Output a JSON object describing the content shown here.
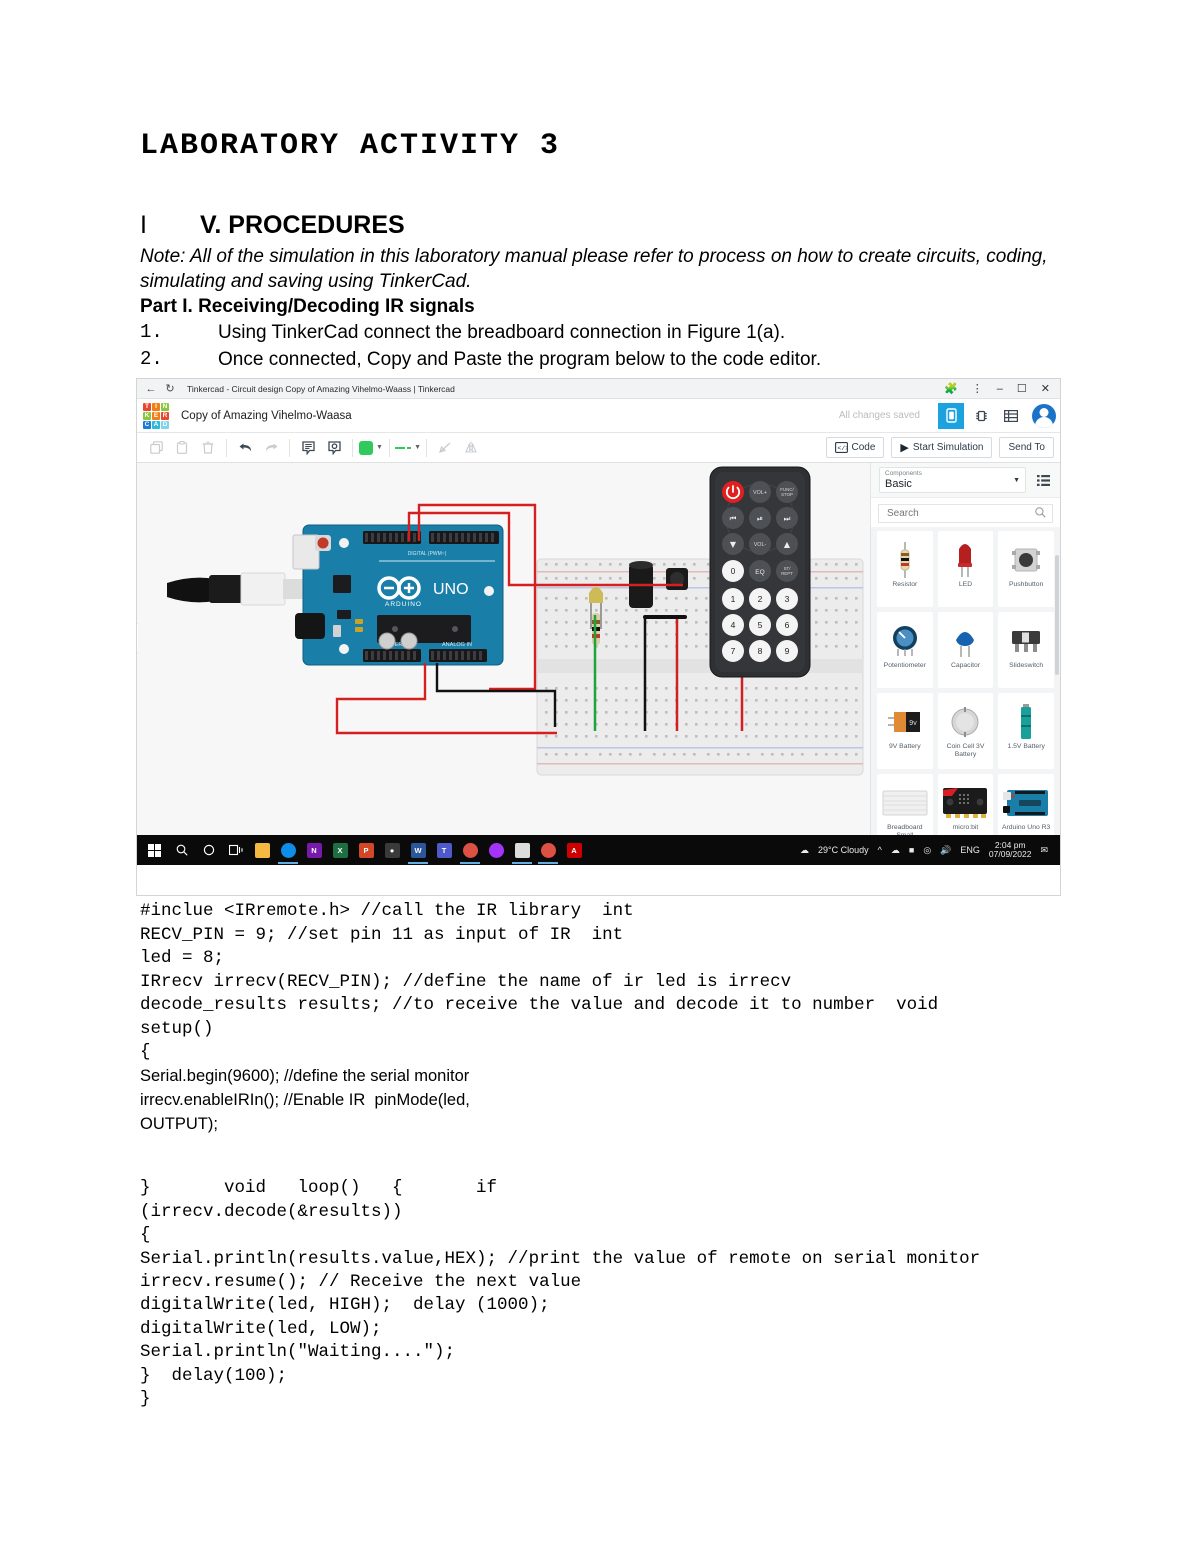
{
  "document": {
    "title": "LABORATORY ACTIVITY 3",
    "section_marker": "I",
    "section_heading": "V. PROCEDURES",
    "note": "Note: All of the simulation in this laboratory manual please refer to process on how to create circuits, coding, simulating and saving using TinkerCad.",
    "part_heading": "Part I. Receiving/Decoding IR signals",
    "steps": [
      {
        "num": "1.",
        "text": "Using TinkerCad connect the breadboard connection in Figure 1(a)."
      },
      {
        "num": "2.",
        "text": "Once connected, Copy and Paste the program below to the code editor."
      }
    ]
  },
  "screenshot": {
    "browser": {
      "tab_title": "Tinkercad - Circuit design Copy of Amazing Vihelmo-Waass | Tinkercad",
      "back_icon": "back-arrow-icon",
      "reload_icon": "reload-icon",
      "extensions_icon": "puzzle-piece-icon",
      "menu_icon": "three-dots-menu-icon",
      "minimize_icon": "minimize-icon",
      "maximize_icon": "maximize-icon",
      "close_icon": "close-icon"
    },
    "appbar": {
      "logo_letters": [
        "T",
        "I",
        "N",
        "K",
        "E",
        "R",
        "C",
        "A",
        "D"
      ],
      "logo_colors": [
        "#e8482c",
        "#f07f1a",
        "#8cc63e",
        "#8cc63e",
        "#f07f1a",
        "#e8482c",
        "#1a7fd4",
        "#2bbbd8",
        "#7fd4f0"
      ],
      "design_name": "Copy of Amazing Vihelmo-Waasa",
      "save_status": "All changes saved",
      "icons": [
        "components-view-icon",
        "chip-view-icon",
        "list-view-icon"
      ],
      "avatar": "user-avatar"
    },
    "toolbar": {
      "icons": [
        "copy-icon",
        "paste-icon",
        "delete-icon",
        "undo-icon",
        "redo-icon",
        "notes-icon",
        "comment-icon"
      ],
      "wire_color": "#2fc95c",
      "wire_style_label": "dashed-line",
      "rotate_icon": "rotate-icon",
      "mirror_icon": "mirror-icon",
      "code_button": "Code",
      "simulate_button": "Start Simulation",
      "sendto_button": "Send To"
    },
    "canvas": {
      "fit_icon": "fit-to-view-icon",
      "board_brand": "ARDUINO",
      "board_model": "UNO",
      "board_digital_label": "DIGITAL (PWM~)",
      "board_power_label": "POWER",
      "board_analog_label": "ANALOG IN",
      "remote": {
        "rows": [
          [
            "power",
            "VOL+",
            "FUNC/STOP"
          ],
          [
            "|<<",
            "▶||",
            ">>|"
          ],
          [
            "▼",
            "VOL-",
            "▲"
          ],
          [
            "0",
            "EQ",
            "ST/REPT"
          ],
          [
            "1",
            "2",
            "3"
          ],
          [
            "4",
            "5",
            "6"
          ],
          [
            "7",
            "8",
            "9"
          ]
        ],
        "power_color": "#e02020"
      }
    },
    "panel": {
      "select_label": "Components",
      "select_value": "Basic",
      "list_icon": "list-view-icon",
      "search_placeholder": "Search",
      "search_icon": "search-icon",
      "collapse_icon": "chevron-right-icon",
      "components": [
        {
          "name": "Resistor",
          "icon": "resistor-icon"
        },
        {
          "name": "LED",
          "icon": "led-icon"
        },
        {
          "name": "Pushbutton",
          "icon": "pushbutton-icon"
        },
        {
          "name": "Potentiometer",
          "icon": "potentiometer-icon"
        },
        {
          "name": "Capacitor",
          "icon": "capacitor-icon"
        },
        {
          "name": "Slideswitch",
          "icon": "slideswitch-icon"
        },
        {
          "name": "9V Battery",
          "icon": "battery-9v-icon"
        },
        {
          "name": "Coin Cell 3V Battery",
          "icon": "coincell-icon"
        },
        {
          "name": "1.5V Battery",
          "icon": "battery-aa-icon"
        },
        {
          "name": "Breadboard Small",
          "icon": "breadboard-icon"
        },
        {
          "name": "micro:bit",
          "icon": "microbit-icon"
        },
        {
          "name": "Arduino Uno R3",
          "icon": "arduino-icon"
        }
      ]
    },
    "taskbar": {
      "system_icons": [
        "start-icon",
        "search-icon",
        "cortana-icon",
        "task-view-icon"
      ],
      "apps": [
        {
          "name": "file-explorer-icon",
          "label": "",
          "color": "#f5b942"
        },
        {
          "name": "teamviewer-icon",
          "label": "",
          "color": "#0e8ee9"
        },
        {
          "name": "onenote-icon",
          "label": "N",
          "color": "#7719aa"
        },
        {
          "name": "excel-icon",
          "label": "X",
          "color": "#1d6f42"
        },
        {
          "name": "powerpoint-icon",
          "label": "P",
          "color": "#d24726"
        },
        {
          "name": "foxit-icon",
          "label": "",
          "color": "#3a3a3a"
        },
        {
          "name": "word-icon",
          "label": "W",
          "color": "#2b579a"
        },
        {
          "name": "teams-icon",
          "label": "T",
          "color": "#5059c9"
        },
        {
          "name": "chrome-icon",
          "label": "",
          "color": "#dd5144"
        },
        {
          "name": "messenger-icon",
          "label": "",
          "color": "#a334fa"
        },
        {
          "name": "photos-icon",
          "label": "",
          "color": "#dcdcdc"
        },
        {
          "name": "chrome-canary-icon",
          "label": "",
          "color": "#dd5144"
        },
        {
          "name": "adobe-reader-icon",
          "label": "A",
          "color": "#cc0000"
        }
      ],
      "weather_icon": "cloud-icon",
      "weather": "29°C  Cloudy",
      "tray_icons": [
        "chevron-up-icon",
        "onedrive-icon",
        "battery-icon",
        "wifi-icon",
        "volume-icon"
      ],
      "language": "ENG",
      "time": "2:04 pm",
      "date": "07/09/2022",
      "notification_icon": "notification-icon"
    }
  },
  "code": {
    "mono_block_1": "#inclue <IRremote.h> //call the IR library  int\nRECV_PIN = 9; //set pin 11 as input of IR  int\nled = 8;\nIRrecv irrecv(RECV_PIN); //define the name of ir led is irrecv\ndecode_results results; //to receive the value and decode it to number  void\nsetup()\n{",
    "sans_block": "Serial.begin(9600); //define the serial monitor\nirrecv.enableIRIn(); //Enable IR  pinMode(led,\nOUTPUT);",
    "mono_block_2": "}       void   loop()   {       if\n(irrecv.decode(&results))\n{\nSerial.println(results.value,HEX); //print the value of remote on serial monitor\nirrecv.resume(); // Receive the next value\ndigitalWrite(led, HIGH);  delay (1000);\ndigitalWrite(led, LOW);\nSerial.println(\"Waiting....\");\n}  delay(100);\n}"
  }
}
